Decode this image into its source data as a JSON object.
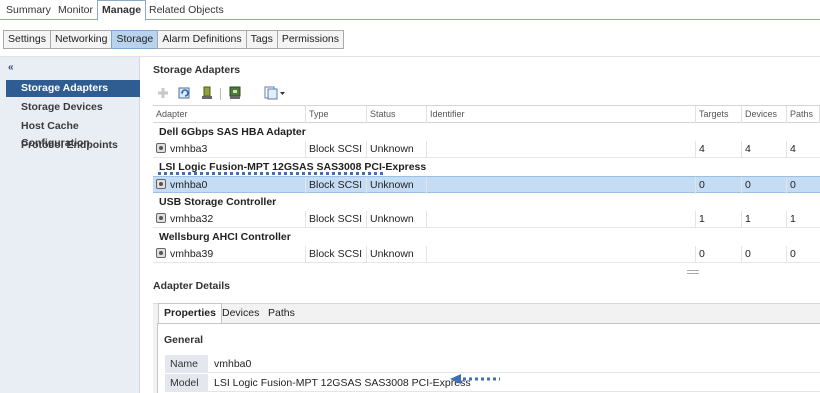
{
  "top_tabs": [
    "Summary",
    "Monitor",
    "Manage",
    "Related Objects"
  ],
  "top_tab_active": "Manage",
  "sub_tabs": [
    "Settings",
    "Networking",
    "Storage",
    "Alarm Definitions",
    "Tags",
    "Permissions"
  ],
  "sub_tab_active": "Storage",
  "sidebar": {
    "collapse_glyph": "«",
    "items": [
      "Storage Adapters",
      "Storage Devices",
      "Host Cache Configuration",
      "Protocol Endpoints"
    ],
    "active": "Storage Adapters"
  },
  "main": {
    "title": "Storage Adapters",
    "toolbar_icons": [
      "add-icon",
      "refresh-icon",
      "rescan-icon",
      "rescan-vmfs-icon",
      "export-icon"
    ]
  },
  "grid": {
    "columns": [
      "Adapter",
      "Type",
      "Status",
      "Identifier",
      "Targets",
      "Devices",
      "Paths"
    ],
    "groups": [
      {
        "name": "Dell 6Gbps SAS HBA Adapter",
        "rows": [
          {
            "adapter": "vmhba3",
            "type": "Block SCSI",
            "status": "Unknown",
            "identifier": "",
            "targets": "4",
            "devices": "4",
            "paths": "4"
          }
        ]
      },
      {
        "name": "LSI Logic Fusion-MPT 12GSAS SAS3008 PCI-Express",
        "rows": [
          {
            "adapter": "vmhba0",
            "type": "Block SCSI",
            "status": "Unknown",
            "identifier": "",
            "targets": "0",
            "devices": "0",
            "paths": "0",
            "selected": true
          }
        ]
      },
      {
        "name": "USB Storage Controller",
        "rows": [
          {
            "adapter": "vmhba32",
            "type": "Block SCSI",
            "status": "Unknown",
            "identifier": "",
            "targets": "1",
            "devices": "1",
            "paths": "1"
          }
        ]
      },
      {
        "name": "Wellsburg AHCI Controller",
        "rows": [
          {
            "adapter": "vmhba39",
            "type": "Block SCSI",
            "status": "Unknown",
            "identifier": "",
            "targets": "0",
            "devices": "0",
            "paths": "0"
          }
        ]
      }
    ]
  },
  "details": {
    "title": "Adapter Details",
    "tabs": [
      "Properties",
      "Devices",
      "Paths"
    ],
    "active_tab": "Properties",
    "section": "General",
    "properties": [
      {
        "key": "Name",
        "value": "vmhba0"
      },
      {
        "key": "Model",
        "value": "LSI Logic Fusion-MPT 12GSAS SAS3008 PCI-Express"
      }
    ]
  },
  "colors": {
    "selection": "#c4ddf5",
    "sidebar_active": "#2f5c91",
    "annotation": "#3f6fb5"
  }
}
